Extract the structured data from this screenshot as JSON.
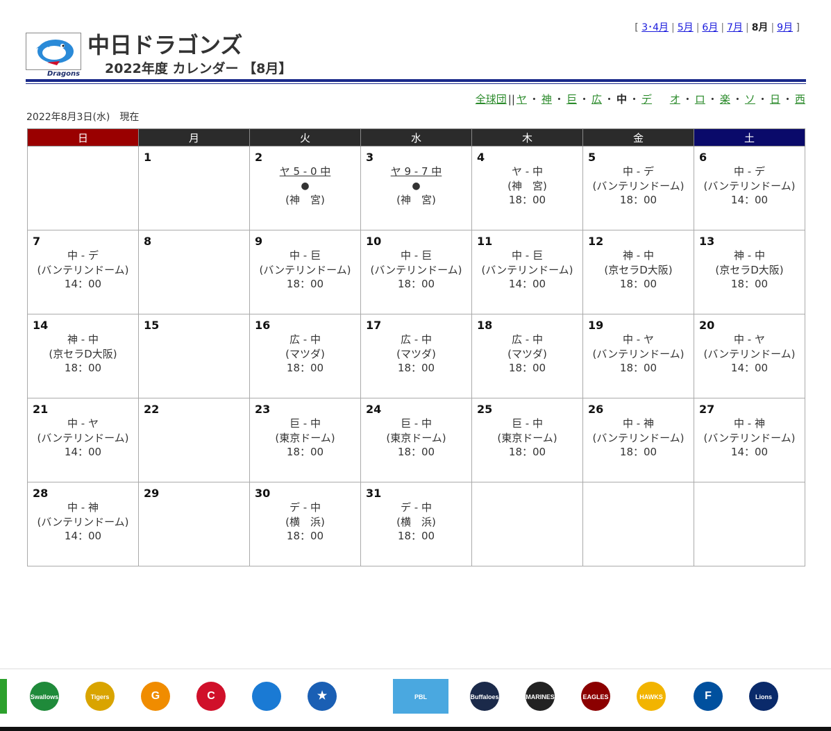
{
  "header": {
    "team_name": "中日ドラゴンズ",
    "subtitle": "2022年度 カレンダー 【8月】",
    "logo_word": "Dragons"
  },
  "month_nav": {
    "items": [
      {
        "label": "3･4月",
        "link": true
      },
      {
        "label": "5月",
        "link": true
      },
      {
        "label": "6月",
        "link": true
      },
      {
        "label": "7月",
        "link": true
      },
      {
        "label": "8月",
        "link": false
      },
      {
        "label": "9月",
        "link": true
      }
    ]
  },
  "team_nav": {
    "all": "全球団",
    "bar": "||",
    "teams": [
      {
        "label": "ヤ",
        "link": true
      },
      {
        "label": "神",
        "link": true
      },
      {
        "label": "巨",
        "link": true
      },
      {
        "label": "広",
        "link": true
      },
      {
        "label": "中",
        "link": false
      },
      {
        "label": "デ",
        "link": true
      },
      {
        "label": "オ",
        "link": true
      },
      {
        "label": "ロ",
        "link": true
      },
      {
        "label": "楽",
        "link": true
      },
      {
        "label": "ソ",
        "link": true
      },
      {
        "label": "日",
        "link": true
      },
      {
        "label": "西",
        "link": true
      }
    ]
  },
  "as_of": "2022年8月3日(水)　現在",
  "weekdays": [
    "日",
    "月",
    "火",
    "水",
    "木",
    "金",
    "土"
  ],
  "weeks": [
    [
      {
        "day": ""
      },
      {
        "day": "1"
      },
      {
        "day": "2",
        "result": "ヤ 5 - 0 中",
        "mark": "●",
        "venue": "(神　宮)"
      },
      {
        "day": "3",
        "result": "ヤ 9 - 7 中",
        "mark": "●",
        "venue": "(神　宮)"
      },
      {
        "day": "4",
        "match": "ヤ - 中",
        "venue": "(神　宮)",
        "time": "18：00"
      },
      {
        "day": "5",
        "match": "中 - デ",
        "venue": "(バンテリンドーム)",
        "time": "18：00"
      },
      {
        "day": "6",
        "match": "中 - デ",
        "venue": "(バンテリンドーム)",
        "time": "14：00"
      }
    ],
    [
      {
        "day": "7",
        "match": "中 - デ",
        "venue": "(バンテリンドーム)",
        "time": "14：00"
      },
      {
        "day": "8"
      },
      {
        "day": "9",
        "match": "中 - 巨",
        "venue": "(バンテリンドーム)",
        "time": "18：00"
      },
      {
        "day": "10",
        "match": "中 - 巨",
        "venue": "(バンテリンドーム)",
        "time": "18：00"
      },
      {
        "day": "11",
        "match": "中 - 巨",
        "venue": "(バンテリンドーム)",
        "time": "14：00"
      },
      {
        "day": "12",
        "match": "神 - 中",
        "venue": "(京セラD大阪)",
        "time": "18：00"
      },
      {
        "day": "13",
        "match": "神 - 中",
        "venue": "(京セラD大阪)",
        "time": "18：00"
      }
    ],
    [
      {
        "day": "14",
        "match": "神 - 中",
        "venue": "(京セラD大阪)",
        "time": "18：00"
      },
      {
        "day": "15"
      },
      {
        "day": "16",
        "match": "広 - 中",
        "venue": "(マツダ)",
        "time": "18：00"
      },
      {
        "day": "17",
        "match": "広 - 中",
        "venue": "(マツダ)",
        "time": "18：00"
      },
      {
        "day": "18",
        "match": "広 - 中",
        "venue": "(マツダ)",
        "time": "18：00"
      },
      {
        "day": "19",
        "match": "中 - ヤ",
        "venue": "(バンテリンドーム)",
        "time": "18：00"
      },
      {
        "day": "20",
        "match": "中 - ヤ",
        "venue": "(バンテリンドーム)",
        "time": "14：00"
      }
    ],
    [
      {
        "day": "21",
        "match": "中 - ヤ",
        "venue": "(バンテリンドーム)",
        "time": "14：00"
      },
      {
        "day": "22"
      },
      {
        "day": "23",
        "match": "巨 - 中",
        "venue": "(東京ドーム)",
        "time": "18：00"
      },
      {
        "day": "24",
        "match": "巨 - 中",
        "venue": "(東京ドーム)",
        "time": "18：00"
      },
      {
        "day": "25",
        "match": "巨 - 中",
        "venue": "(東京ドーム)",
        "time": "18：00"
      },
      {
        "day": "26",
        "match": "中 - 神",
        "venue": "(バンテリンドーム)",
        "time": "18：00"
      },
      {
        "day": "27",
        "match": "中 - 神",
        "venue": "(バンテリンドーム)",
        "time": "14：00"
      }
    ],
    [
      {
        "day": "28",
        "match": "中 - 神",
        "venue": "(バンテリンドーム)",
        "time": "14：00"
      },
      {
        "day": "29"
      },
      {
        "day": "30",
        "match": "デ - 中",
        "venue": "(横　浜)",
        "time": "18：00"
      },
      {
        "day": "31",
        "match": "デ - 中",
        "venue": "(横　浜)",
        "time": "18：00"
      },
      {
        "day": ""
      },
      {
        "day": ""
      },
      {
        "day": ""
      }
    ]
  ],
  "footer_logos": [
    {
      "name": "swallows-logo",
      "text": "Swallows",
      "color": "#1f8a3a"
    },
    {
      "name": "tigers-logo",
      "text": "Tigers",
      "color": "#d9a400"
    },
    {
      "name": "giants-logo",
      "text": "G",
      "color": "#f08c00"
    },
    {
      "name": "carp-logo",
      "text": "C",
      "color": "#d0102a"
    },
    {
      "name": "dragons-logo",
      "text": "",
      "color": "#1a7ad4"
    },
    {
      "name": "baystars-logo",
      "text": "★",
      "color": "#1a5fb4"
    },
    {
      "name": "pbl-logo",
      "text": "PBL",
      "color": "#4aa8e0"
    },
    {
      "name": "buffaloes-logo",
      "text": "Buffaloes",
      "color": "#1b2a4a"
    },
    {
      "name": "marines-logo",
      "text": "MARINES",
      "color": "#222222"
    },
    {
      "name": "eagles-logo",
      "text": "EAGLES",
      "color": "#8b0000"
    },
    {
      "name": "hawks-logo",
      "text": "HAWKS",
      "color": "#f2b400"
    },
    {
      "name": "fighters-logo",
      "text": "F",
      "color": "#00509e"
    },
    {
      "name": "lions-logo",
      "text": "Lions",
      "color": "#0a2a6a"
    }
  ]
}
